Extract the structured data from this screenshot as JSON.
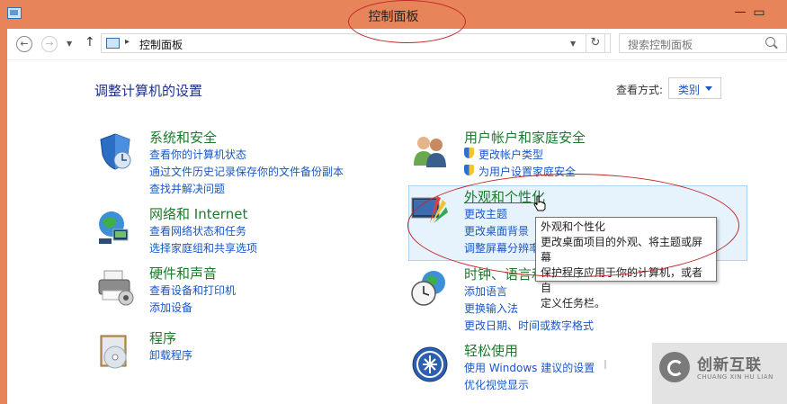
{
  "window": {
    "title": "控制面板",
    "minimize": "—",
    "maximize": "▭"
  },
  "address_bar": {
    "path": "控制面板",
    "separator": "▸",
    "search_placeholder": "搜索控制面板"
  },
  "header": {
    "title": "调整计算机的设置",
    "view_label": "查看方式:",
    "view_value": "类别"
  },
  "categories": [
    {
      "name": "系统和安全",
      "links": [
        "查看你的计算机状态",
        "通过文件历史记录保存你的文件备份副本",
        "查找并解决问题"
      ]
    },
    {
      "name": "网络和 Internet",
      "links": [
        "查看网络状态和任务",
        "选择家庭组和共享选项"
      ]
    },
    {
      "name": "硬件和声音",
      "links": [
        "查看设备和打印机",
        "添加设备"
      ]
    },
    {
      "name": "程序",
      "links": [
        "卸载程序"
      ]
    },
    {
      "name": "用户帐户和家庭安全",
      "links": [
        "更改帐户类型",
        "为用户设置家庭安全"
      ]
    },
    {
      "name": "外观和个性化",
      "links": [
        "更改主题",
        "更改桌面背景",
        "调整屏幕分辨率"
      ]
    },
    {
      "name": "时钟、语言和区域",
      "links": [
        "添加语言",
        "更换输入法",
        "更改日期、时间或数字格式"
      ]
    },
    {
      "name": "轻松使用",
      "links": [
        "使用 Windows 建议的设置",
        "优化视觉显示"
      ]
    }
  ],
  "tooltip": {
    "title": "外观和个性化",
    "lines": [
      "更改桌面项目的外观、将主题或屏幕",
      "保护程序应用于你的计算机，或者自",
      "定义任务栏。"
    ]
  },
  "watermark": {
    "brand": "创新互联",
    "sub": "CHUANG XIN HU LIAN"
  },
  "colors": {
    "titlebar": "#e8845a",
    "heading_green": "#1d7a2d",
    "link_blue": "#1a57c5",
    "title_blue": "#1e3287",
    "annotation_red": "#c0282a"
  }
}
